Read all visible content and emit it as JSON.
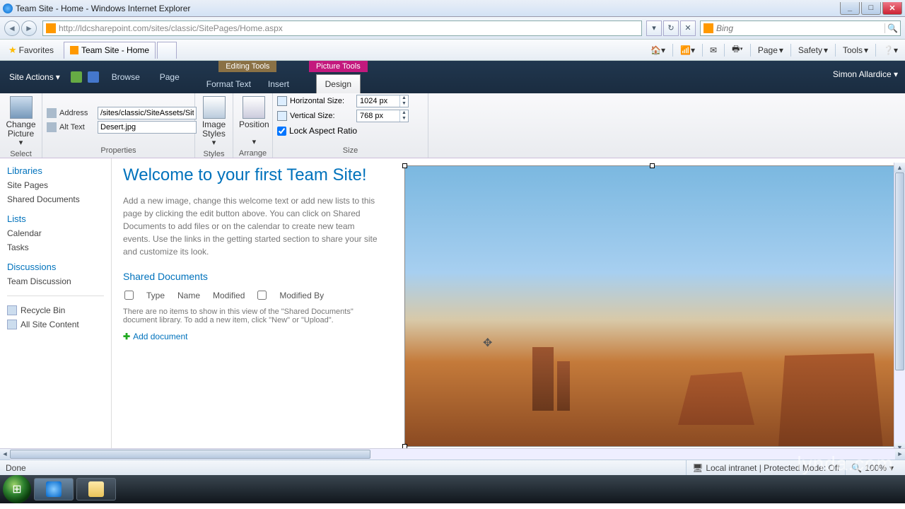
{
  "window": {
    "title": "Team Site - Home - Windows Internet Explorer"
  },
  "nav": {
    "url": "http://ldcsharepoint.com/sites/classic/SitePages/Home.aspx",
    "search_placeholder": "Bing"
  },
  "favorites": {
    "label": "Favorites",
    "tab_title": "Team Site - Home"
  },
  "toolmenu": {
    "page": "Page",
    "safety": "Safety",
    "tools": "Tools"
  },
  "ribbon": {
    "site_actions": "Site Actions",
    "browse": "Browse",
    "page": "Page",
    "editing_tools": "Editing Tools",
    "format_text": "Format Text",
    "insert": "Insert",
    "picture_tools": "Picture Tools",
    "design": "Design",
    "user": "Simon Allardice"
  },
  "ribbon_body": {
    "change_picture": "Change Picture",
    "select_group": "Select",
    "address_lbl": "Address",
    "address_val": "/sites/classic/SiteAssets/Site",
    "alt_lbl": "Alt Text",
    "alt_val": "Desert.jpg",
    "properties_group": "Properties",
    "image_styles": "Image Styles",
    "position": "Position",
    "styles_group": "Styles",
    "arrange_group": "Arrange",
    "hsize_lbl": "Horizontal Size:",
    "hsize_val": "1024 px",
    "vsize_lbl": "Vertical Size:",
    "vsize_val": "768 px",
    "lock_aspect": "Lock Aspect Ratio",
    "size_group": "Size"
  },
  "quicklaunch": {
    "libraries": "Libraries",
    "site_pages": "Site Pages",
    "shared_docs": "Shared Documents",
    "lists": "Lists",
    "calendar": "Calendar",
    "tasks": "Tasks",
    "discussions": "Discussions",
    "team_discussion": "Team Discussion",
    "recycle": "Recycle Bin",
    "all_content": "All Site Content"
  },
  "main": {
    "welcome_title": "Welcome to your first Team Site!",
    "welcome_body": "Add a new image, change this welcome text or add new lists to this page by clicking the edit button above. You can click on Shared Documents to add files or on the calendar to create new team events. Use the links in the getting started section to share your site and customize its look.",
    "sd_head": "Shared Documents",
    "col_type": "Type",
    "col_name": "Name",
    "col_modified": "Modified",
    "col_modified_by": "Modified By",
    "sd_empty": "There are no items to show in this view of the \"Shared Documents\" document library. To add a new item, click \"New\" or \"Upload\".",
    "add_doc": "Add document"
  },
  "status": {
    "done": "Done",
    "zone": "Local intranet | Protected Mode: Off",
    "zoom": "100%"
  },
  "watermark": "lynda.com"
}
